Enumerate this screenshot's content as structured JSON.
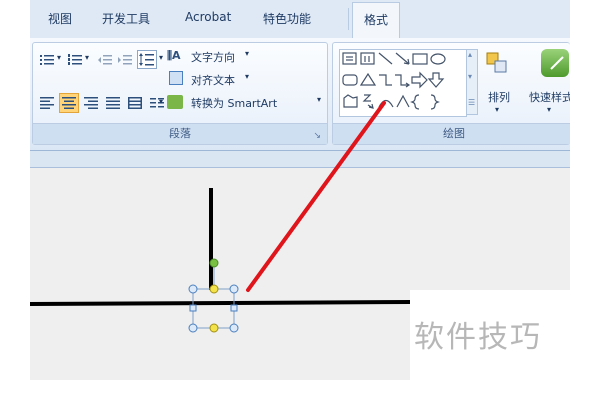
{
  "tabs": [
    "视图",
    "开发工具",
    "Acrobat",
    "特色功能",
    "格式"
  ],
  "paragraph_group": {
    "text_direction_label": "文字方向",
    "align_text_label": "对齐文本",
    "convert_smartart_label": "转换为 SmartArt",
    "group_label": "段落"
  },
  "drawing_group": {
    "arrange_label": "排列",
    "quick_styles_label": "快速样式",
    "group_label": "绘图"
  },
  "watermark": "软件技巧",
  "colors": {
    "ribbon_bg": "#dfe9f6",
    "arrow_red": "#e0141b",
    "handle_green": "#7ac143",
    "handle_yellow": "#f3e24a",
    "handle_blue": "#4a7fbf"
  }
}
